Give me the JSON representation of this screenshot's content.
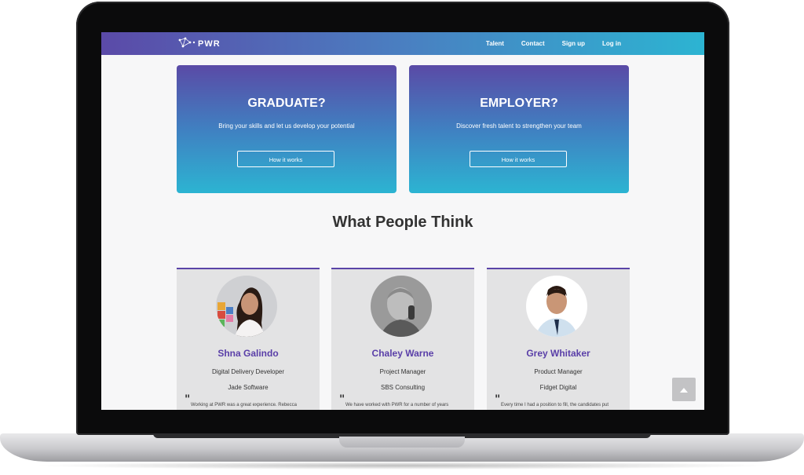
{
  "nav": {
    "logo_text": "PWR",
    "links": [
      "Talent",
      "Contact",
      "Sign up",
      "Log in"
    ]
  },
  "hero": [
    {
      "title": "GRADUATE?",
      "subtitle": "Bring your skills and let us develop your potential",
      "button": "How it works"
    },
    {
      "title": "EMPLOYER?",
      "subtitle": "Discover fresh talent to strengthen your team",
      "button": "How it works"
    }
  ],
  "testimonials": {
    "title": "What People Think",
    "people": [
      {
        "name": "Shna Galindo",
        "role": "Digital Delivery Developer",
        "company": "Jade Software",
        "quote": "Working at PWR was a great experience. Rebecca"
      },
      {
        "name": "Chaley Warne",
        "role": "Project Manager",
        "company": "SBS Consulting",
        "quote": "We have worked with PWR for a number of years"
      },
      {
        "name": "Grey Whitaker",
        "role": "Product Manager",
        "company": "Fidget Digital",
        "quote": "Every time I had a position to fill, the candidates put"
      }
    ]
  },
  "colors": {
    "brand_purple": "#5a44a8",
    "brand_cyan": "#2cb4d2"
  },
  "icons": {
    "logo": "constellation-icon",
    "scroll_top": "chevron-up-icon"
  }
}
